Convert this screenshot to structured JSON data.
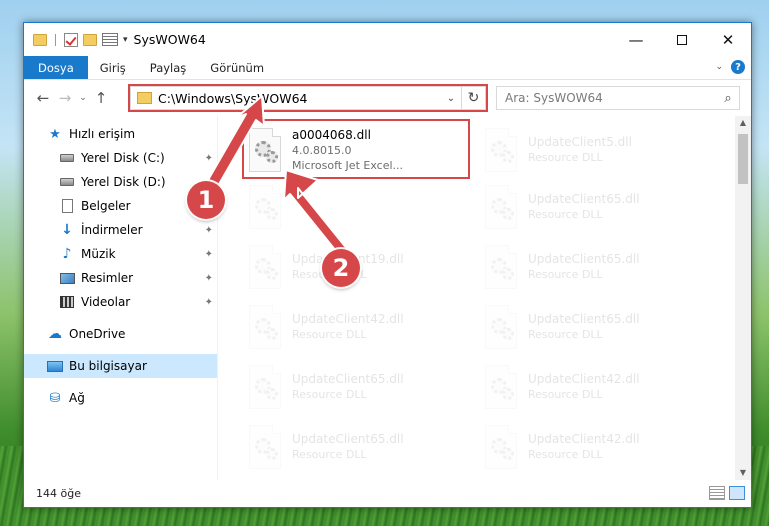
{
  "window": {
    "title": "SysWOW64",
    "controls": {
      "minimize": "—",
      "maximize": "",
      "close": "✕"
    }
  },
  "ribbon": {
    "tabs": [
      "Dosya",
      "Giriş",
      "Paylaş",
      "Görünüm"
    ],
    "help": "?"
  },
  "navigation": {
    "back": "←",
    "forward": "→",
    "recent": "⌄",
    "up": "↑",
    "address": "C:\\Windows\\SysWOW64",
    "search_placeholder": "Ara: SysWOW64"
  },
  "sidebar": {
    "quick_access": "Hızlı erişim",
    "items": [
      {
        "label": "Yerel Disk (C:)",
        "icon": "drive-icon",
        "pinned": true
      },
      {
        "label": "Yerel Disk (D:)",
        "icon": "drive-icon",
        "pinned": false
      },
      {
        "label": "Belgeler",
        "icon": "documents-icon",
        "pinned": true
      },
      {
        "label": "İndirmeler",
        "icon": "downloads-icon",
        "pinned": true
      },
      {
        "label": "Müzik",
        "icon": "music-icon",
        "pinned": true
      },
      {
        "label": "Resimler",
        "icon": "pictures-icon",
        "pinned": true
      },
      {
        "label": "Videolar",
        "icon": "videos-icon",
        "pinned": true
      }
    ],
    "onedrive": "OneDrive",
    "this_pc": "Bu bilgisayar",
    "network": "Ağ"
  },
  "files": {
    "highlighted": {
      "name": "a0004068.dll",
      "version": "4.0.8015.0",
      "description": "Microsoft Jet Excel..."
    },
    "left_column": [
      {
        "name": "",
        "description": ""
      },
      {
        "name": "UpdateClient19.dll",
        "description": "Resource DLL"
      },
      {
        "name": "UpdateClient42.dll",
        "description": "Resource DLL"
      },
      {
        "name": "UpdateClient65.dll",
        "description": "Resource DLL"
      },
      {
        "name": "UpdateClient65.dll",
        "description": "Resource DLL"
      }
    ],
    "right_column": [
      {
        "name": "UpdateClient5.dll",
        "description": "Resource DLL"
      },
      {
        "name": "UpdateClient65.dll",
        "description": "Resource DLL"
      },
      {
        "name": "UpdateClient65.dll",
        "description": "Resource DLL"
      },
      {
        "name": "UpdateClient65.dll",
        "description": "Resource DLL"
      },
      {
        "name": "UpdateClient42.dll",
        "description": "Resource DLL"
      },
      {
        "name": "UpdateClient42.dll",
        "description": "Resource DLL"
      }
    ]
  },
  "status": {
    "item_count": "144 öğe"
  },
  "annotations": {
    "badge_1": "1",
    "badge_2": "2",
    "accent": "#d6474a"
  },
  "colors": {
    "file_tab": "#1979ca",
    "selection": "#cce8ff"
  }
}
